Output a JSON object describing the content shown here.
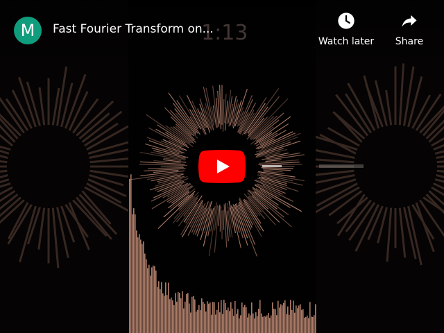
{
  "channel": {
    "avatar_letter": "M",
    "avatar_color": "#0f9d7e"
  },
  "video": {
    "title": "Fast Fourier Transform on...",
    "overlay_time": "1:13"
  },
  "actions": {
    "watch_later": {
      "label": "Watch later",
      "icon": "clock-icon"
    },
    "share": {
      "label": "Share",
      "icon": "share-arrow-icon"
    }
  },
  "play_button": {
    "icon": "play-icon",
    "color": "#ff0000"
  },
  "colors": {
    "spectrum": "#c9917a",
    "background": "#050303"
  }
}
